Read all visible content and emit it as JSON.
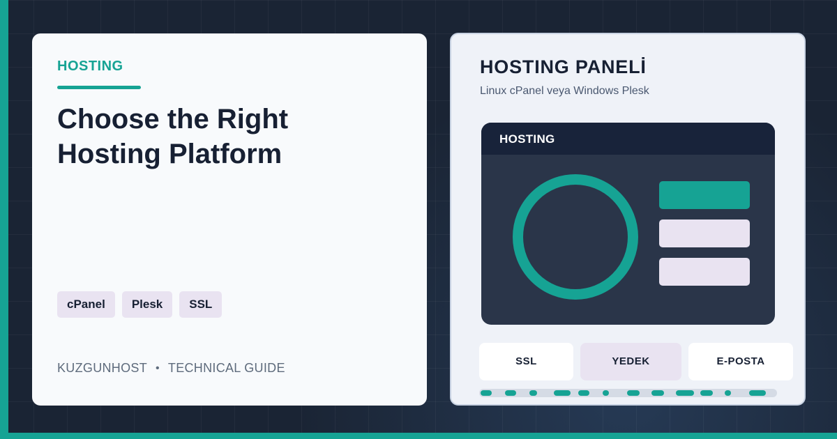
{
  "left_card": {
    "eyebrow": "HOSTING",
    "title_line1": "Choose the Right",
    "title_line2": "Hosting Platform",
    "tags": [
      "cPanel",
      "Plesk",
      "SSL"
    ],
    "brand": "KUZGUNHOST",
    "separator": "•",
    "category": "TECHNICAL GUIDE"
  },
  "right_card": {
    "title": "HOSTING PANELİ",
    "subtitle": "Linux cPanel veya Windows Plesk",
    "window_title": "HOSTING",
    "pills": [
      "SSL",
      "YEDEK",
      "E-POSTA"
    ]
  },
  "colors": {
    "accent": "#16a394",
    "navy": "#172033",
    "lavender": "#e9e3f1",
    "background": "#1a2434"
  }
}
